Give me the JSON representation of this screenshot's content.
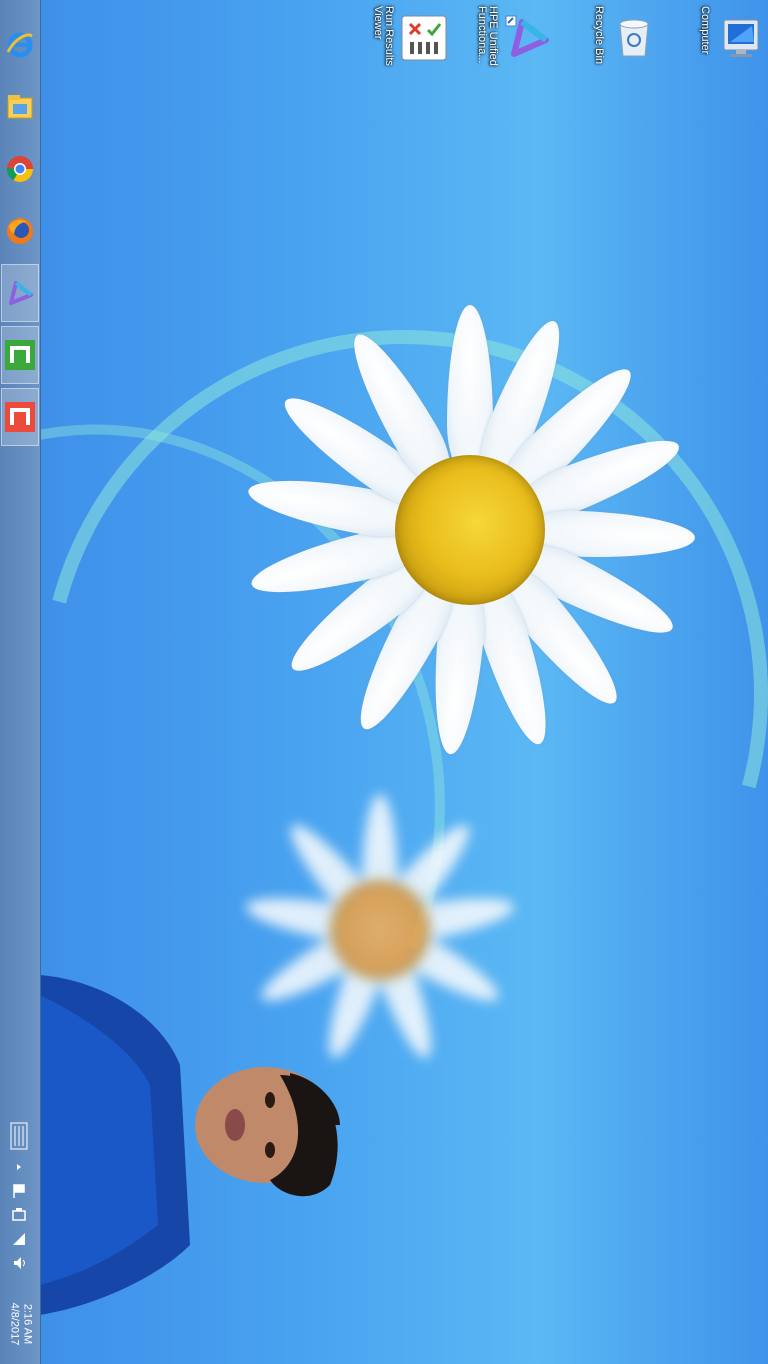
{
  "taskbar": {
    "pinned": [
      {
        "name": "internet-explorer-icon"
      },
      {
        "name": "file-explorer-icon"
      },
      {
        "name": "chrome-icon"
      },
      {
        "name": "firefox-icon"
      },
      {
        "name": "hpe-uft-icon"
      },
      {
        "name": "green-app-icon"
      },
      {
        "name": "red-app-icon"
      }
    ],
    "clock": {
      "time": "2:16 AM",
      "date": "4/8/2017"
    }
  },
  "desktop": {
    "icons": [
      {
        "label_lines": [
          "Computer"
        ]
      },
      {
        "label_lines": [
          "Recycle Bin"
        ]
      },
      {
        "label_lines": [
          "HPE Unified",
          "Functiona..."
        ]
      },
      {
        "label_lines": [
          "Run Results",
          "Viewer"
        ]
      }
    ]
  },
  "colors": {
    "taskbar": "#6990c2",
    "wallpaper_blue": "#49a3f0",
    "flower_center": "#e9be1c"
  }
}
